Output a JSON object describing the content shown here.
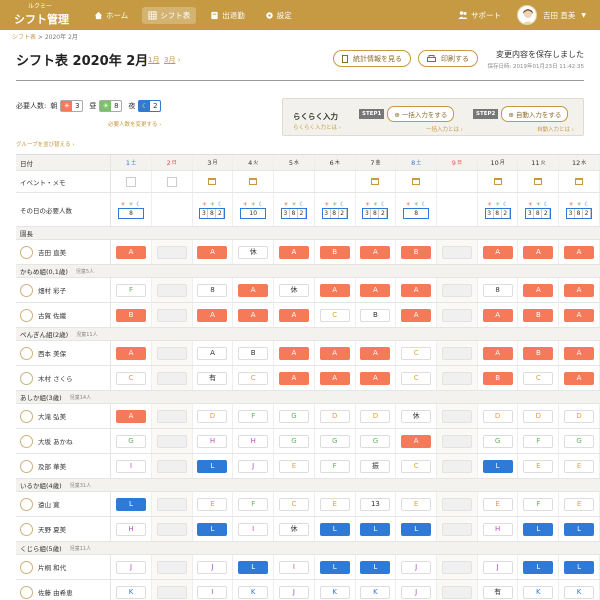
{
  "header": {
    "logo_sub": "ルクミー",
    "logo_main": "シフト管理",
    "nav": [
      {
        "label": "ホーム",
        "icon": "home-icon"
      },
      {
        "label": "シフト表",
        "icon": "grid-icon"
      },
      {
        "label": "出退勤",
        "icon": "clock-card-icon"
      },
      {
        "label": "設定",
        "icon": "gear-icon"
      }
    ],
    "support": "サポート",
    "user": "吉田 直美"
  },
  "breadcrumb": {
    "link": "シフト表",
    "current": "2020年 2月"
  },
  "title": "シフト表 2020年 2月",
  "pager": {
    "prev": "1月",
    "next": "3月"
  },
  "buttons": {
    "stats": "統計情報を見る",
    "print": "印刷する"
  },
  "save": {
    "status": "変更内容を保存しました",
    "time": "保存日時: 2019年01月23日 11:42:35"
  },
  "required": {
    "label": "必要人数:",
    "items": [
      {
        "label": "朝",
        "icon": "☀",
        "value": "3",
        "color": "#f47a5a"
      },
      {
        "label": "昼",
        "icon": "☀",
        "value": "8",
        "color": "#7cc16a"
      },
      {
        "label": "夜",
        "icon": "☾",
        "value": "2",
        "color": "#2f7ad6"
      }
    ],
    "link": "必要人数を変更する ›"
  },
  "easy": {
    "title": "らくらく入力",
    "link": "らくらく入力とは ›",
    "step1": {
      "badge": "STEP1",
      "button": "一括入力をする",
      "link": "一括入力とは ›"
    },
    "step2": {
      "badge": "STEP2",
      "button": "自動入力をする",
      "link": "自動入力とは ›"
    }
  },
  "group_link": "グループを並び替える ›",
  "table": {
    "head_label": "日付",
    "days": [
      {
        "d": "1",
        "w": "土",
        "c": "#2f7ad6"
      },
      {
        "d": "2",
        "w": "日",
        "c": "#e05050"
      },
      {
        "d": "3",
        "w": "月",
        "c": "#333"
      },
      {
        "d": "4",
        "w": "火",
        "c": "#333"
      },
      {
        "d": "5",
        "w": "水",
        "c": "#333"
      },
      {
        "d": "6",
        "w": "木",
        "c": "#333"
      },
      {
        "d": "7",
        "w": "金",
        "c": "#333"
      },
      {
        "d": "8",
        "w": "土",
        "c": "#2f7ad6"
      },
      {
        "d": "9",
        "w": "日",
        "c": "#e05050"
      },
      {
        "d": "10",
        "w": "月",
        "c": "#333"
      },
      {
        "d": "11",
        "w": "火",
        "c": "#333"
      },
      {
        "d": "12",
        "w": "水",
        "c": "#333"
      }
    ],
    "event_label": "イベント・メモ",
    "need_label": "その日の必要人数"
  },
  "rows": [
    {
      "type": "group",
      "name": "園長",
      "note": ""
    },
    {
      "type": "person",
      "name": "吉田 直美",
      "cells": [
        "A:o",
        ":e",
        "A:o",
        "休",
        "A:o",
        "B:o",
        "A:o",
        "B:o",
        ":e",
        "A:o",
        "A:o",
        "A:o"
      ]
    },
    {
      "type": "group",
      "name": "かもめ組(0,1歳)",
      "note": "児童5人"
    },
    {
      "type": "person",
      "name": "畑村 彩子",
      "cells": [
        "F",
        ":e",
        "8:45-12:00",
        "A:o",
        "休",
        "A:o",
        "A:o",
        "A:o",
        ":e",
        "8:45-17:00",
        "A:o",
        "A:o"
      ]
    },
    {
      "type": "person",
      "name": "古賀 佐織",
      "cells": [
        "B:o",
        ":e",
        "A:o",
        "A:o",
        "A:o",
        "C",
        "B",
        "A:o",
        ":e",
        "A:o",
        "B:o",
        "A:o"
      ]
    },
    {
      "type": "group",
      "name": "ぺんぎん組(2歳)",
      "note": "児童11人"
    },
    {
      "type": "person",
      "name": "西本 美保",
      "cells": [
        "A:o",
        ":e",
        "A",
        "B",
        "A:o",
        "A:o",
        "A:o",
        "C",
        ":e",
        "A:o",
        "B:o",
        "A:o"
      ]
    },
    {
      "type": "person",
      "name": "木村 さくら",
      "cells": [
        "C",
        ":e",
        "有",
        "C",
        "A:o",
        "A:o",
        "A:o",
        "C",
        ":e",
        "B:o",
        "C",
        "A:o"
      ]
    },
    {
      "type": "group",
      "name": "あしか組(3歳)",
      "note": "児童14人"
    },
    {
      "type": "person",
      "name": "大滝 弘美",
      "cells": [
        "A:o",
        ":e",
        "D",
        "F",
        "G",
        "D",
        "D",
        "休",
        ":e",
        "D",
        "D",
        "D"
      ]
    },
    {
      "type": "person",
      "name": "大坂 あかね",
      "cells": [
        "G",
        ":e",
        "H",
        "H",
        "G",
        "G",
        "G",
        "A:o",
        ":e",
        "G",
        "F",
        "G"
      ]
    },
    {
      "type": "person",
      "name": "及部 華美",
      "cells": [
        "I",
        ":e",
        "L:b",
        "J",
        "E",
        "F",
        "振",
        "C",
        ":e",
        "L:b",
        "E",
        "E"
      ]
    },
    {
      "type": "group",
      "name": "いるか組(4歳)",
      "note": "児童31人"
    },
    {
      "type": "person",
      "name": "遠山 寛",
      "cells": [
        "L:b",
        ":e",
        "E",
        "F",
        "C",
        "E",
        "13:00-15:45",
        "E",
        ":e",
        "E",
        "F",
        "E"
      ]
    },
    {
      "type": "person",
      "name": "天野 夏美",
      "cells": [
        "H",
        ":e",
        "L:b",
        "I",
        "休",
        "L:b",
        "L:b",
        "L:b",
        ":e",
        "H",
        "L:b",
        "L:b"
      ]
    },
    {
      "type": "group",
      "name": "くじら組(5歳)",
      "note": "児童11人"
    },
    {
      "type": "person",
      "name": "片桐 和代",
      "cells": [
        "J",
        ":e",
        "J",
        "L:b",
        "I",
        "L:b",
        "L:b",
        "J",
        ":e",
        "J",
        "L:b",
        "L:b"
      ]
    },
    {
      "type": "person",
      "name": "佐藤 由希恵",
      "cells": [
        "K",
        ":e",
        "I",
        "K",
        "J",
        "K",
        "K",
        "J",
        ":e",
        "有",
        "K",
        "K"
      ]
    }
  ],
  "letter_colors": {
    "C": "#e0a528",
    "D": "#e0a528",
    "E": "#d0b020",
    "F": "#5cb85c",
    "G": "#5cb85c",
    "H": "#c050c0",
    "I": "#c050c0",
    "J": "#a050c0",
    "K": "#2f7ad6",
    "有": "#333",
    "休": "#333",
    "振": "#333"
  }
}
